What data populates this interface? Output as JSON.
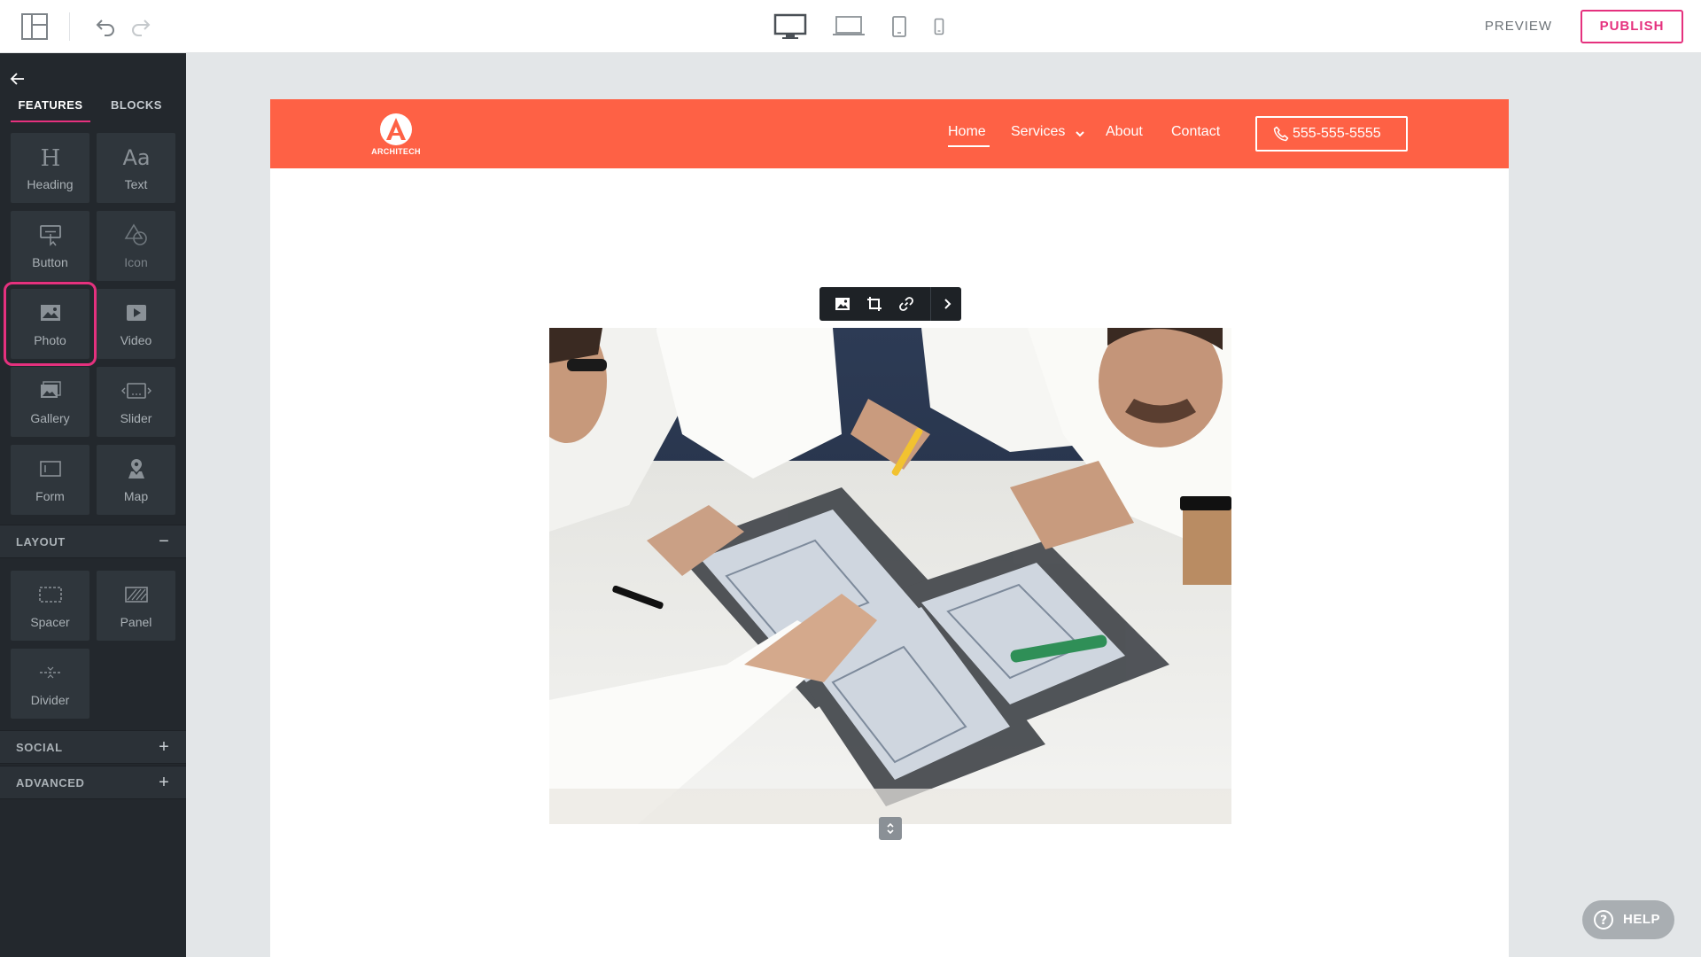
{
  "topbar": {
    "preview_label": "PREVIEW",
    "publish_label": "PUBLISH",
    "devices": [
      "desktop-icon",
      "laptop-icon",
      "tablet-icon",
      "phone-icon"
    ],
    "active_device": "desktop"
  },
  "sidebar": {
    "tabs": [
      {
        "label": "FEATURES",
        "active": true
      },
      {
        "label": "BLOCKS",
        "active": false
      }
    ],
    "features": [
      {
        "label": "Heading",
        "icon": "heading-icon"
      },
      {
        "label": "Text",
        "icon": "text-icon"
      },
      {
        "label": "Button",
        "icon": "button-icon"
      },
      {
        "label": "Icon",
        "icon": "shapes-icon",
        "disabled": true
      },
      {
        "label": "Photo",
        "icon": "photo-icon",
        "selected": true
      },
      {
        "label": "Video",
        "icon": "video-icon"
      },
      {
        "label": "Gallery",
        "icon": "gallery-icon"
      },
      {
        "label": "Slider",
        "icon": "slider-icon"
      },
      {
        "label": "Form",
        "icon": "form-icon"
      },
      {
        "label": "Map",
        "icon": "map-icon"
      }
    ],
    "layout": {
      "label": "LAYOUT",
      "toggle": "−",
      "items": [
        {
          "label": "Spacer",
          "icon": "spacer-icon"
        },
        {
          "label": "Panel",
          "icon": "panel-icon"
        },
        {
          "label": "Divider",
          "icon": "divider-icon"
        }
      ]
    },
    "social": {
      "label": "SOCIAL",
      "toggle": "+"
    },
    "advanced": {
      "label": "ADVANCED",
      "toggle": "+"
    }
  },
  "site": {
    "logo_text": "ARCHITECH",
    "nav": {
      "home": "Home",
      "services": "Services",
      "about": "About",
      "contact": "Contact",
      "active": "Home"
    },
    "phone": "555-555-5555",
    "brand_color": "#fe6145"
  },
  "image_toolbar": [
    "image-icon",
    "crop-icon",
    "link-icon",
    "chevron-right-icon"
  ],
  "help_label": "HELP",
  "accent_color": "#e5317e"
}
